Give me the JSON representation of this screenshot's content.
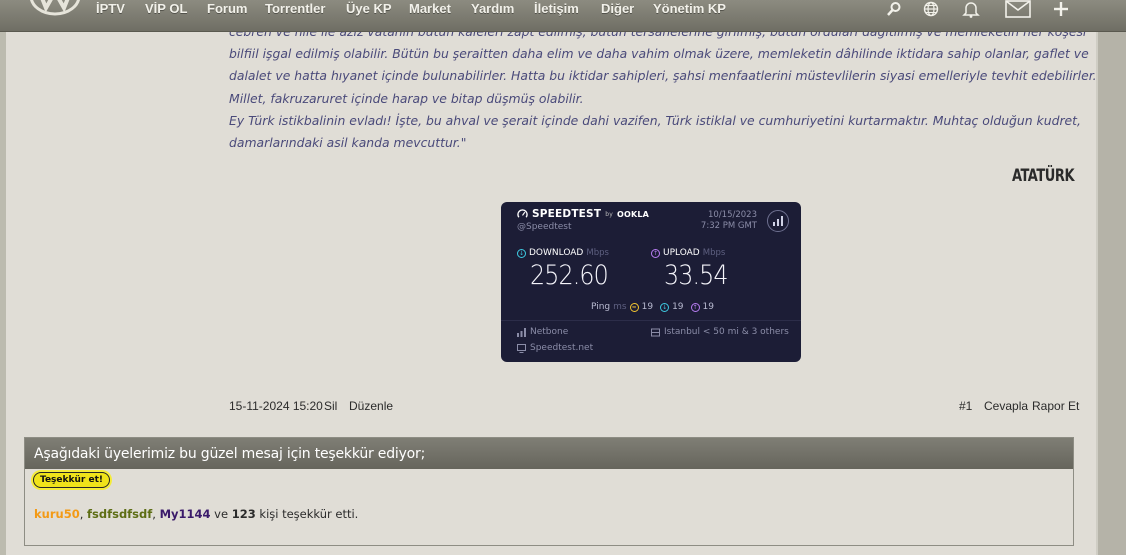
{
  "nav": {
    "items": [
      "İPTV",
      "VİP OL",
      "Forum",
      "Torrentler",
      "Üye KP",
      "Market",
      "Yardım",
      "İletişim",
      "Diğer",
      "Yönetim KP"
    ],
    "icons": [
      "search-icon",
      "globe-icon",
      "bell-icon",
      "mail-icon",
      "plus-icon"
    ]
  },
  "post": {
    "quote_lines": [
      "cebren ve hile ile aziz vatanın bütün kaleleri zapt edilmiş, bütün tersanelerine girilmiş, bütün orduları dağıtılmış ve memleketin her köşesi",
      "bilfiil işgal edilmiş olabilir. Bütün bu şeraitten daha elim ve daha vahim olmak üzere, memleketin dâhilinde iktidara sahip olanlar, gaflet ve",
      "dalalet ve hatta hıyanet içinde bulunabilirler. Hatta bu iktidar sahipleri, şahsi menfaatlerini müstevlilerin siyasi emelleriyle tevhit edebilirler.",
      "Millet, fakruzaruret içinde harap ve bitap düşmüş olabilir.",
      "Ey Türk istikbalinin evladı! İşte, bu ahval ve şerait içinde dahi vazifen, Türk istiklal ve cumhuriyetini kurtarmaktır. Muhtaç olduğun kudret,",
      "damarlarındaki asil kanda mevcuttur.\""
    ],
    "author": "ATATÜRK",
    "date": "15-11-2024 15:20",
    "delete_label": "Sil",
    "edit_label": "Düzenle",
    "post_number": "#1",
    "reply_label": "Cevapla",
    "report_label": "Rapor Et"
  },
  "speedtest": {
    "brand": "SPEEDTEST",
    "by": "by",
    "ookla": "OOKLA",
    "handle": "@Speedtest",
    "date": "10/15/2023",
    "time": "7:32 PM GMT",
    "download_label": "DOWNLOAD",
    "upload_label": "UPLOAD",
    "unit": "Mbps",
    "download": "252.60",
    "upload": "33.54",
    "ping_label": "Ping",
    "ping_unit": "ms",
    "ping_idle": "19",
    "ping_down": "19",
    "ping_up": "19",
    "isp": "Netbone",
    "server": "Istanbul < 50 mi & 3 others",
    "site": "Speedtest.net",
    "colors": {
      "bg": "#1c1d36",
      "download": "#3ec9e0",
      "upload": "#b67cf0",
      "ping": "#f2c430"
    }
  },
  "thanks": {
    "header": "Aşağıdaki üyelerimiz bu güzel mesaj için teşekkür ediyor;",
    "button": "Teşekkür et!",
    "user1": "kuru50",
    "user2": "fsdfsdfsdf",
    "user3": "My1144",
    "sep": ", ",
    "ve": " ve ",
    "count": "123",
    "suffix": " kişi teşekkür etti."
  }
}
